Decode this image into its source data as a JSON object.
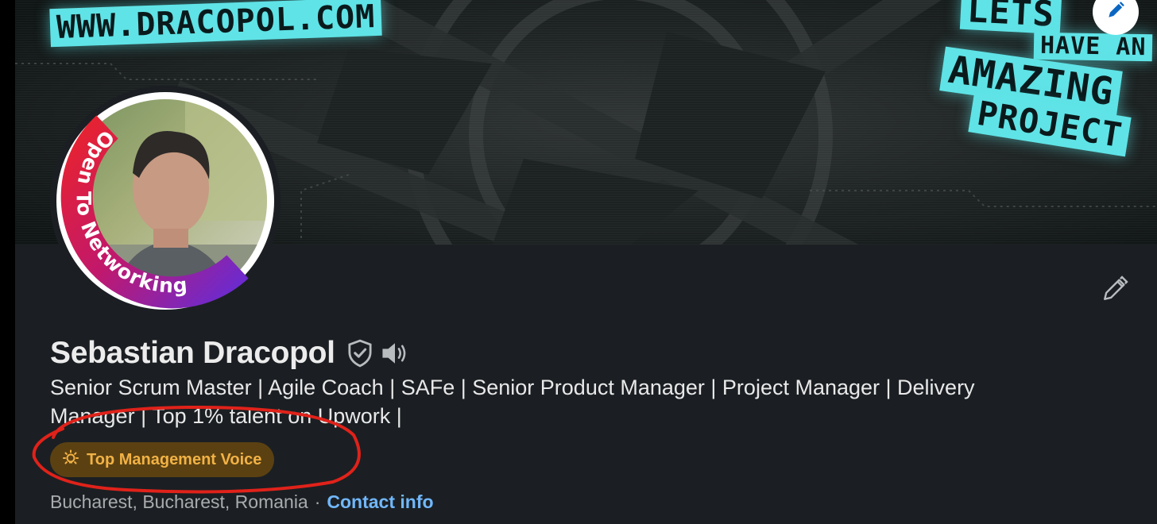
{
  "banner": {
    "url_text": "WWW.DRACOPOL.COM",
    "slogan_lines": [
      "LETS",
      "HAVE AN",
      "AMAZING",
      "PROJECT"
    ]
  },
  "avatar": {
    "ring_text": "Open To Networking",
    "ring_colors": [
      "#e8232f",
      "#c2186b",
      "#6a2bd1"
    ]
  },
  "profile": {
    "name": "Sebastian Dracopol",
    "headline": "Senior Scrum Master | Agile Coach | SAFe | Senior Product Manager | Project Manager | Delivery Manager | Top 1% talent on Upwork |",
    "badge_label": "Top Management Voice",
    "location": "Bucharest, Bucharest, Romania",
    "separator": "·",
    "contact_link": "Contact info"
  },
  "icons": {
    "verification": "shield-check-icon",
    "name_pronunciation": "speaker-icon",
    "badge": "lightbulb-icon",
    "edit_banner": "pencil-icon",
    "edit_intro": "pencil-icon"
  },
  "colors": {
    "card_bg": "#1b1f23",
    "banner_accent": "#5fe3e6",
    "badge_bg": "#5b4112",
    "badge_text": "#f2b245",
    "link": "#71b7fb",
    "annotation": "#e0221a"
  }
}
